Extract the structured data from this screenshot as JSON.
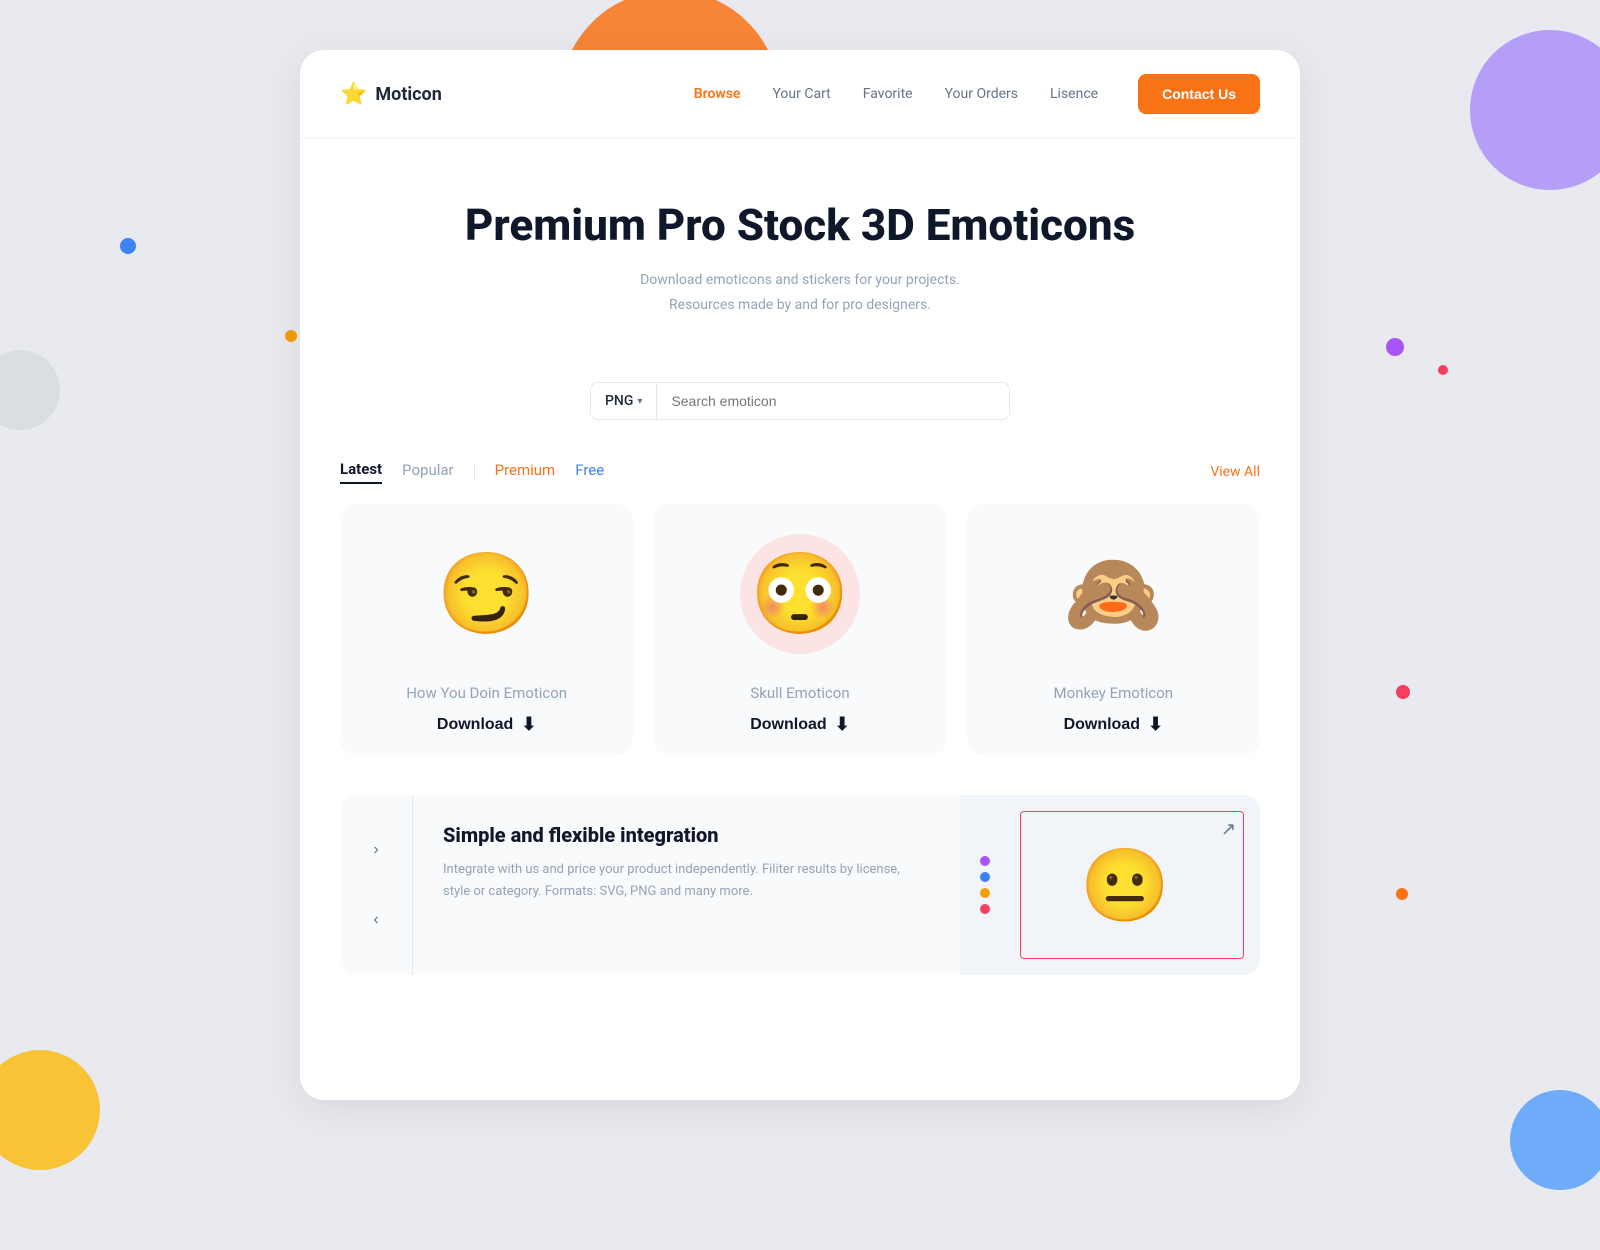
{
  "background": {
    "blobs": [
      "orange-top",
      "peach",
      "purple-tr",
      "blue-tr",
      "yellow-bl",
      "gray-left"
    ]
  },
  "navbar": {
    "logo_icon": "⭐",
    "logo_text": "Moticon",
    "links": [
      {
        "label": "Browse",
        "active": true
      },
      {
        "label": "Your Cart",
        "active": false
      },
      {
        "label": "Favorite",
        "active": false
      },
      {
        "label": "Your Orders",
        "active": false
      },
      {
        "label": "Lisence",
        "active": false
      }
    ],
    "contact_label": "Contact Us"
  },
  "hero": {
    "title": "Premium Pro Stock 3D Emoticons",
    "subtitle_line1": "Download emoticons and stickers for your projects.",
    "subtitle_line2": "Resources made by and for pro designers."
  },
  "search": {
    "format_label": "PNG",
    "chevron": "▾",
    "placeholder": "Search emoticon"
  },
  "tabs": {
    "items": [
      {
        "label": "Latest",
        "active": true
      },
      {
        "label": "Popular",
        "active": false
      },
      {
        "label": "Premium",
        "type": "premium"
      },
      {
        "label": "Free",
        "type": "free"
      }
    ],
    "view_all": "View All"
  },
  "cards": [
    {
      "emoji": "😏",
      "name": "How You Doin Emoticon",
      "download_label": "Download",
      "download_icon": "⬇"
    },
    {
      "emoji": "😳",
      "name": "Skull Emoticon",
      "download_label": "Download",
      "download_icon": "⬇",
      "skull": true
    },
    {
      "emoji": "🙈",
      "name": "Monkey Emoticon",
      "download_label": "Download",
      "download_icon": "⬇"
    }
  ],
  "integration": {
    "title": "Simple and flexible integration",
    "description": "Integrate with us and price your product independently. Filiter results by license, style or category. Formats: SVG, PNG and many more.",
    "prev_arrow": "›",
    "next_arrow": "‹",
    "preview_dots": [
      {
        "color": "#a855f7"
      },
      {
        "color": "#3b82f6"
      },
      {
        "color": "#f59e0b"
      },
      {
        "color": "#f43f5e"
      }
    ],
    "preview_emoji": "😐"
  }
}
